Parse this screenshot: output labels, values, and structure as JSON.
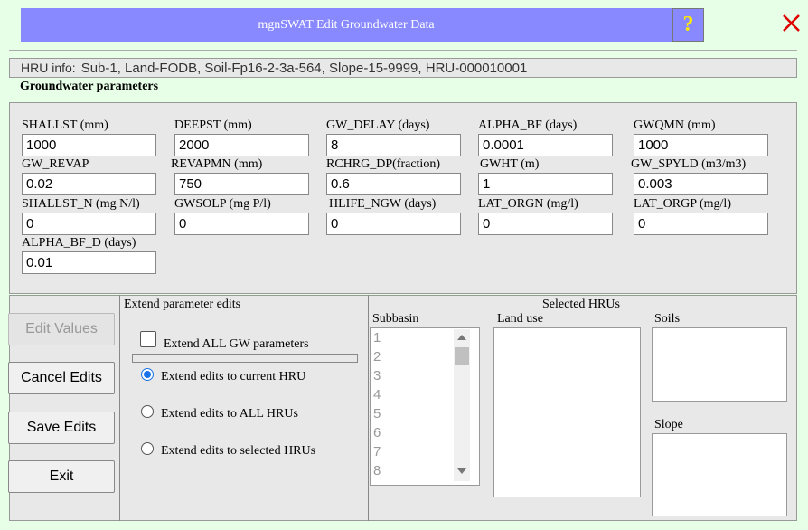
{
  "window": {
    "title": "mgnSWAT Edit Groundwater Data",
    "help_glyph": "?"
  },
  "hru_info": {
    "label": "HRU info:",
    "value": "Sub-1, Land-FODB, Soil-Fp16-2-3a-564, Slope-15-9999, HRU-000010001"
  },
  "gw_heading": "Groundwater parameters",
  "params": [
    {
      "label": "SHALLST (mm)",
      "value": "1000"
    },
    {
      "label": "DEEPST (mm)",
      "value": "2000"
    },
    {
      "label": "GW_DELAY (days)",
      "value": "8"
    },
    {
      "label": "ALPHA_BF (days)",
      "value": "0.0001"
    },
    {
      "label": "GWQMN (mm)",
      "value": "1000"
    },
    {
      "label": "GW_REVAP",
      "value": "0.02"
    },
    {
      "label": "REVAPMN (mm)",
      "value": "750"
    },
    {
      "label": "RCHRG_DP(fraction)",
      "value": "0.6"
    },
    {
      "label": "GWHT (m)",
      "value": "1"
    },
    {
      "label": "GW_SPYLD (m3/m3)",
      "value": "0.003"
    },
    {
      "label": "SHALLST_N (mg N/l)",
      "value": "0"
    },
    {
      "label": "GWSOLP (mg P/l)",
      "value": "0"
    },
    {
      "label": "HLIFE_NGW (days)",
      "value": "0"
    },
    {
      "label": "LAT_ORGN (mg/l)",
      "value": "0"
    },
    {
      "label": "LAT_ORGP (mg/l)",
      "value": "0"
    },
    {
      "label": "ALPHA_BF_D (days)",
      "value": "0.01"
    }
  ],
  "buttons": {
    "edit_values": "Edit Values",
    "cancel_edits": "Cancel Edits",
    "save_edits": "Save Edits",
    "exit": "Exit"
  },
  "extend": {
    "title": "Extend parameter edits",
    "all_gw_label": "Extend ALL GW parameters",
    "all_gw_checked": false,
    "options": [
      {
        "label": "Extend edits to current HRU",
        "selected": true
      },
      {
        "label": "Extend edits to ALL HRUs",
        "selected": false
      },
      {
        "label": "Extend edits to selected HRUs",
        "selected": false
      }
    ]
  },
  "selected_hrus": {
    "title": "Selected HRUs",
    "subbasin_label": "Subbasin",
    "landuse_label": "Land use",
    "soils_label": "Soils",
    "slope_label": "Slope",
    "subbasins": [
      "1",
      "2",
      "3",
      "4",
      "5",
      "6",
      "7",
      "8"
    ]
  },
  "colors": {
    "background": "#e6ffe6",
    "title_bar": "#8888ff",
    "help_glyph": "#ffea00",
    "close": "#e00000",
    "radio_selected": "#1a73e8"
  }
}
